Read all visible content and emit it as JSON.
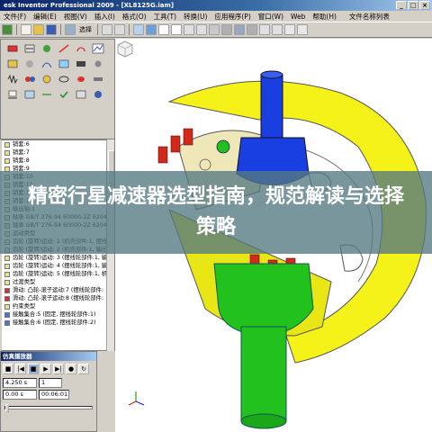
{
  "window": {
    "title": "esk Inventor Professional 2009 - [XL8125G.iam]",
    "min": "_",
    "max": "□",
    "close": "×"
  },
  "menu": {
    "items": [
      "文件(F)",
      "编辑(E)",
      "视图(V)",
      "插入(I)",
      "格式(O)",
      "工具(T)",
      "转换(U)",
      "应用程序(P)",
      "窗口(W)",
      "Web"
    ],
    "help_label": "帮助(H)",
    "doc_list_label": "文件名称列表"
  },
  "toolbar": {
    "select_label": "选择"
  },
  "tree": {
    "items": [
      {
        "label": "销套:6",
        "kind": "plain"
      },
      {
        "label": "销套:7",
        "kind": "plain"
      },
      {
        "label": "销套:8",
        "kind": "plain"
      },
      {
        "label": "销套:9",
        "kind": "plain"
      },
      {
        "label": "销套:10",
        "kind": "plain"
      },
      {
        "label": "销套:11",
        "kind": "plain"
      },
      {
        "label": "销套:12",
        "kind": "plain"
      },
      {
        "label": "销套:13",
        "kind": "plain"
      },
      {
        "label": "输出轴:1",
        "kind": "plain"
      },
      {
        "label": "轴承 GB/T 276-94 60000-2Z 6204",
        "kind": "plain"
      },
      {
        "label": "轴承 GB/T 276-94 60000-2Z 6204",
        "kind": "plain"
      },
      {
        "label": "运动类型",
        "kind": "plain"
      },
      {
        "label": "齿轮 (旋转)运动: 1 (机壳部件:1, 摆线",
        "kind": "plain"
      },
      {
        "label": "齿轮 (旋转)运动: 2 (机壳部件:1, 输出",
        "kind": "plain"
      },
      {
        "label": "齿轮 (旋转)运动: 3 (摆线轮部件:1, 输",
        "kind": "plain"
      },
      {
        "label": "齿轮 (旋转)运动: 4 (摆线轮部件:1, 输",
        "kind": "plain"
      },
      {
        "label": "齿轮 (旋转)运动: 5 (摆线轮部件:1, 机",
        "kind": "plain"
      },
      {
        "label": "过渡类型",
        "kind": "plain"
      },
      {
        "label": "滑动: 凸轮-滚子运动:7 (摆线轮部件:",
        "kind": "red"
      },
      {
        "label": "滑动: 凸轮-滚子运动:8 (摆线轮部件:",
        "kind": "red"
      },
      {
        "label": "约束类型",
        "kind": "plain"
      },
      {
        "label": "接触集合:5 (固定, 摆线轮部件:1)",
        "kind": "blue"
      },
      {
        "label": "接触集合:6 (固定, 摆线轮部件:2)",
        "kind": "blue"
      }
    ]
  },
  "sim": {
    "title": "仿真播放器",
    "time_value": "4.250 s",
    "step_value": "1",
    "elapsed": "0.00 s",
    "total": "00:06:01"
  },
  "overlay": {
    "title": "精密行星减速器选型指南，规范解读与选择策略"
  },
  "colors": {
    "yellow_part": "#f5f21a",
    "green_part": "#22c11e",
    "blue_part": "#1a3fe0",
    "red_part": "#d22a1a",
    "overlay_bg": "#55788280"
  }
}
